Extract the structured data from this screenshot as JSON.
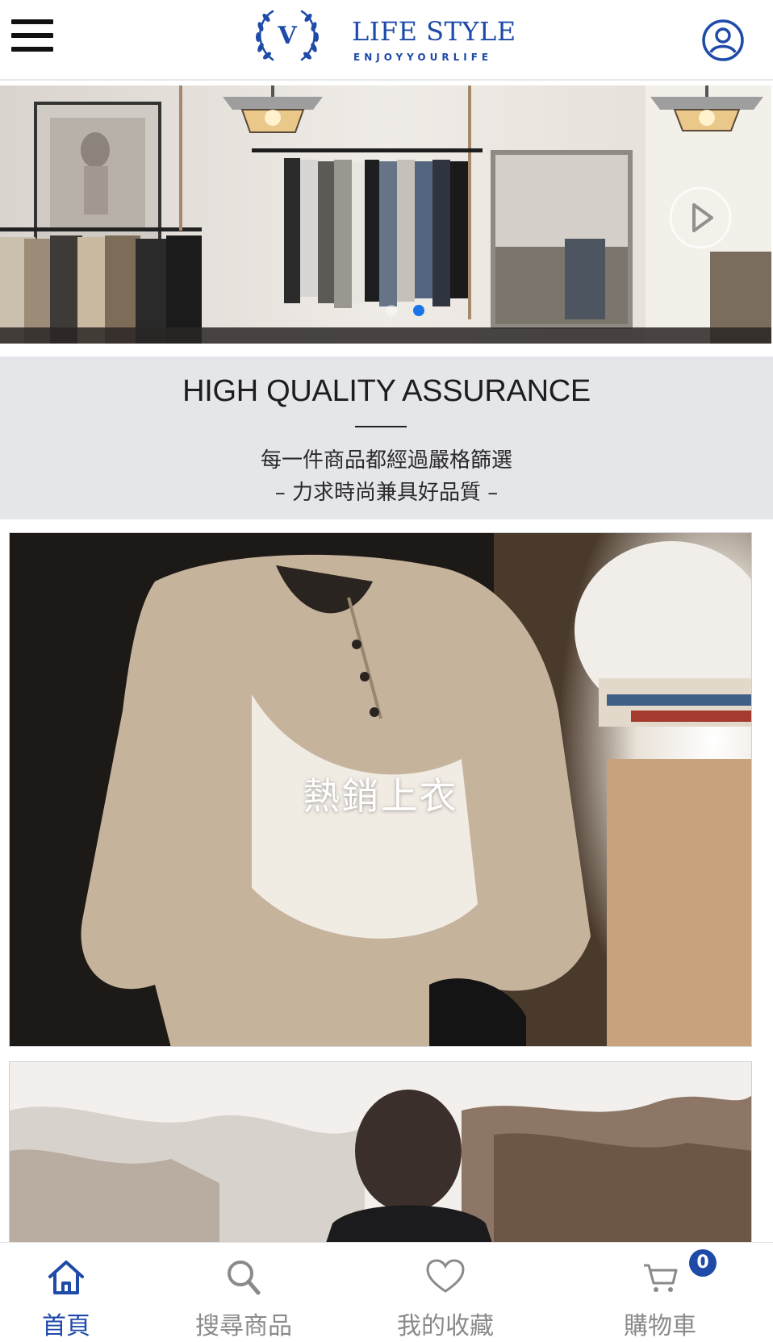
{
  "header": {
    "brand_initial": "V",
    "brand_title": "LIFE STYLE",
    "brand_tagline": "ENJOYYOURLIFE",
    "brand_color": "#1e4aa8"
  },
  "carousel": {
    "active_slide": 2,
    "slide_count": 2,
    "next_icon": "play-arrow-icon"
  },
  "quality": {
    "title": "HIGH QUALITY ASSURANCE",
    "line1": "每一件商品都經過嚴格篩選",
    "line2": "– 力求時尚兼具好品質 –"
  },
  "categories": [
    {
      "label": "熱銷上衣"
    },
    {
      "label": ""
    }
  ],
  "bottom_nav": {
    "items": [
      {
        "label": "首頁",
        "icon": "home-icon",
        "active": true
      },
      {
        "label": "搜尋商品",
        "icon": "search-icon",
        "active": false
      },
      {
        "label": "我的收藏",
        "icon": "heart-icon",
        "active": false
      },
      {
        "label": "購物車",
        "icon": "cart-icon",
        "active": false
      }
    ],
    "cart_count": "0",
    "active_color": "#1e4aa8",
    "inactive_color": "#8a8a8a"
  }
}
